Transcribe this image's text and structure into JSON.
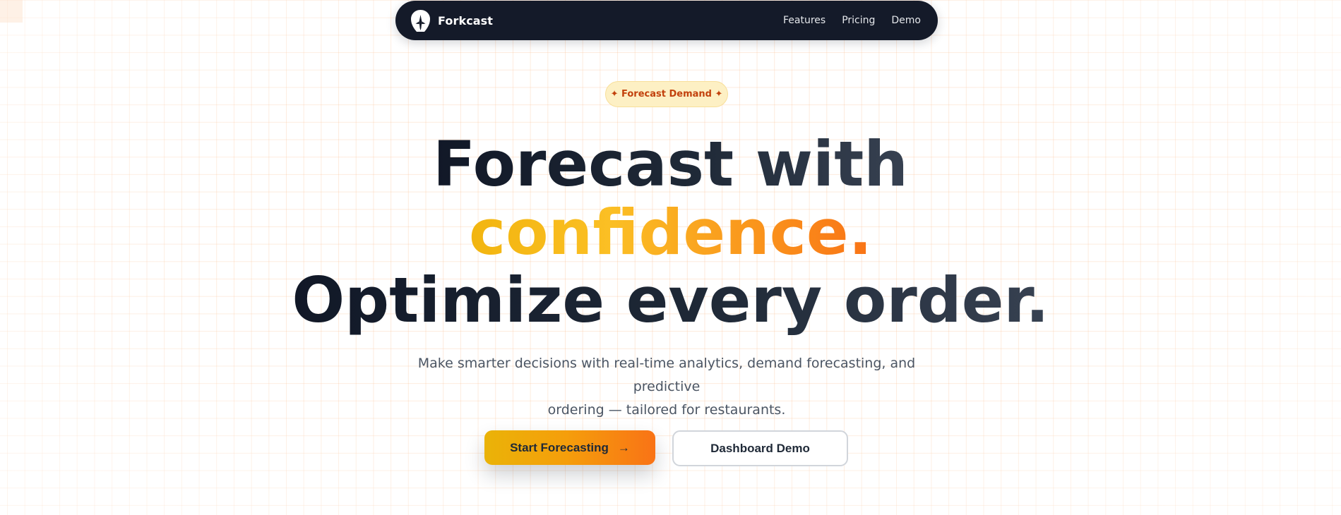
{
  "navbar": {
    "logo_icon": "rocket-icon",
    "brand_name": "Forkcast",
    "links": [
      "Features",
      "Pricing",
      "Demo"
    ]
  },
  "hero": {
    "badge": "✦ Forecast Demand ✦",
    "headline_line1": "Forecast with",
    "headline_accent": "confidence.",
    "headline_line3": "Optimize every order.",
    "subtitle_line1": "Make smarter decisions with real-time analytics, demand forecasting, and predictive",
    "subtitle_line2": "ordering — tailored for restaurants.",
    "primary_button": "Start Forecasting",
    "primary_button_icon": "→",
    "secondary_button": "Dashboard Demo"
  },
  "colors": {
    "navbar_bg": "#141a29",
    "accent_start": "#eab308",
    "accent_end": "#f97316",
    "badge_bg": "#fdf0c4",
    "badge_text": "#c2410c",
    "grid_line": "#fbb078",
    "headline_dark": "#111827"
  }
}
